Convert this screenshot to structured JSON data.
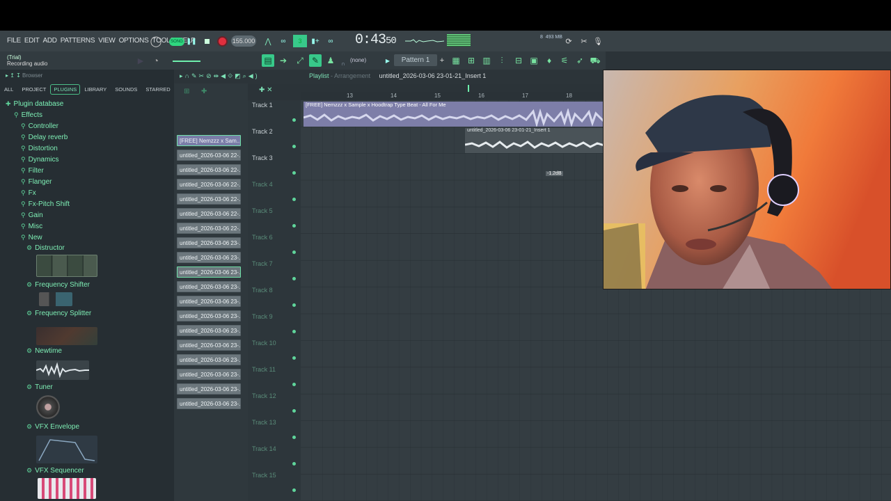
{
  "menu": [
    "FILE",
    "EDIT",
    "ADD",
    "PATTERNS",
    "VIEW",
    "OPTIONS",
    "TOOLS",
    "HELP"
  ],
  "transport": {
    "mode_label": "SONG",
    "tempo": "155.000",
    "time_main": "0:43",
    "time_sub": "50",
    "memory": "493 MB",
    "cpu": "8"
  },
  "hint": {
    "title": "(Trial)",
    "text": "Recording audio"
  },
  "toolbar": {
    "snap": "(none)",
    "pattern": "Pattern 1"
  },
  "browser": {
    "title": "Browser",
    "tabs": [
      "ALL",
      "PROJECT",
      "PLUGINS",
      "LIBRARY",
      "SOUNDS",
      "STARRED"
    ],
    "active_tab": "PLUGINS",
    "root": "Plugin database",
    "effects": "Effects",
    "folders": [
      "Controller",
      "Delay reverb",
      "Distortion",
      "Dynamics",
      "Filter",
      "Flanger",
      "Fx",
      "Fx-Pitch Shift",
      "Gain",
      "Misc",
      "New"
    ],
    "new_plugins": [
      "Distructor",
      "Frequency Shifter",
      "Frequency Splitter",
      "Newtime",
      "Tuner",
      "VFX Envelope",
      "VFX Sequencer"
    ]
  },
  "clips": [
    "[FREE] Nemzzz x Sam..",
    "untitled_2026-03-06 22-..",
    "untitled_2026-03-06 22-..",
    "untitled_2026-03-06 22-..",
    "untitled_2026-03-06 22-..",
    "untitled_2026-03-06 22-..",
    "untitled_2026-03-06 22-..",
    "untitled_2026-03-06 23-..",
    "untitled_2026-03-06 23-..",
    "untitled_2026-03-06 23-..",
    "untitled_2026-03-06 23-..",
    "untitled_2026-03-06 23-..",
    "untitled_2026-03-06 23-..",
    "untitled_2026-03-06 23-..",
    "untitled_2026-03-06 23-..",
    "untitled_2026-03-06 23-..",
    "untitled_2026-03-06 23-..",
    "untitled_2026-03-06 23-..",
    "untitled_2026-03-06 23-.."
  ],
  "playlist": {
    "title": "Playlist",
    "sep": "-",
    "subtitle": "Arrangement",
    "file": "untitled_2026-03-06 23-01-21_Insert 1",
    "ruler": [
      "13",
      "14",
      "15",
      "16",
      "17",
      "18"
    ],
    "clip1": "[FREE] Nemzzz x Sample x Hoodtrap Type Beat - All For Me",
    "clip2": "untitled_2026-03-06 23-01-21_Insert 1",
    "clip2_vol": "-1.2dB",
    "tracks": [
      "Track 1",
      "Track 2",
      "Track 3",
      "Track 4",
      "Track 5",
      "Track 6",
      "Track 7",
      "Track 8",
      "Track 9",
      "Track 10",
      "Track 11",
      "Track 12",
      "Track 13",
      "Track 14",
      "Track 15"
    ]
  }
}
